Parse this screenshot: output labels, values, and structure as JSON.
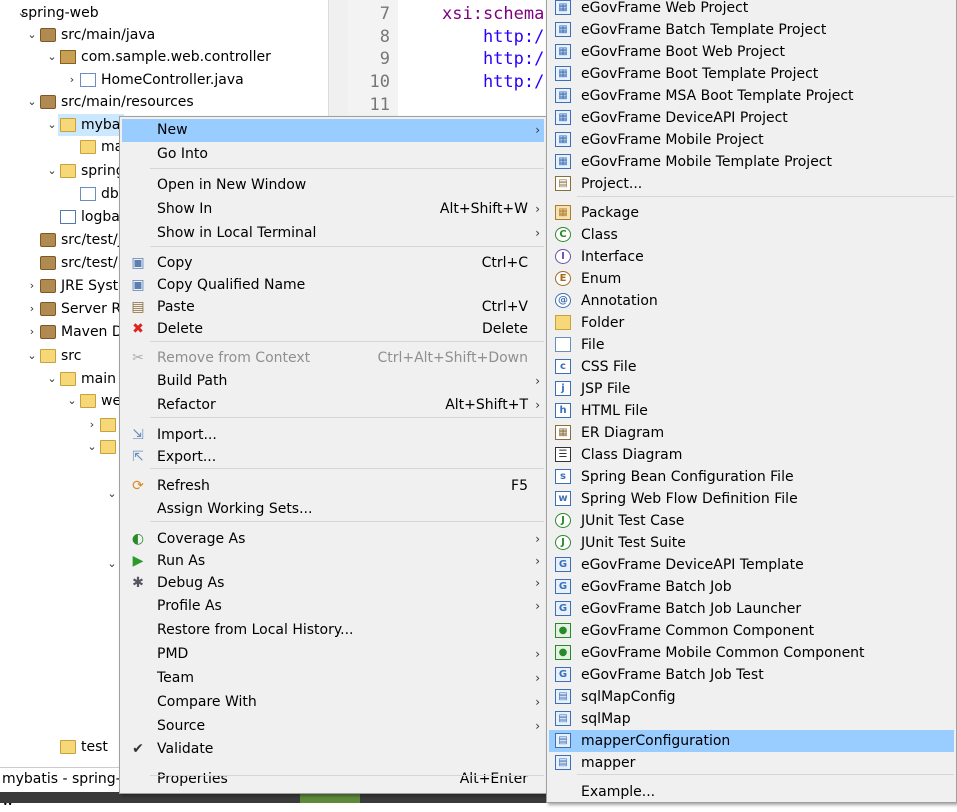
{
  "explorer": {
    "items": [
      {
        "label": "spring-web",
        "twisty": "⌄",
        "icon": "project-icon"
      },
      {
        "label": "src/main/java",
        "twisty": "⌄",
        "icon": "source-folder-icon"
      },
      {
        "label": "com.sample.web.controller",
        "twisty": "⌄",
        "icon": "package-icon"
      },
      {
        "label": "HomeController.java",
        "twisty": "›",
        "icon": "java-file-icon"
      },
      {
        "label": "src/main/resources",
        "twisty": "⌄",
        "icon": "source-folder-icon"
      },
      {
        "label": "myba",
        "twisty": "⌄",
        "icon": "folder-icon"
      },
      {
        "label": "ma",
        "twisty": "",
        "icon": "folder-icon"
      },
      {
        "label": "spring",
        "twisty": "⌄",
        "icon": "folder-icon"
      },
      {
        "label": "db",
        "twisty": "",
        "icon": "properties-file-icon"
      },
      {
        "label": "logba",
        "twisty": "",
        "icon": "xml-file-icon"
      },
      {
        "label": "src/test/j",
        "twisty": "",
        "icon": "source-folder-icon"
      },
      {
        "label": "src/test/r",
        "twisty": "",
        "icon": "source-folder-icon"
      },
      {
        "label": "JRE Syste",
        "twisty": "›",
        "icon": "library-icon"
      },
      {
        "label": "Server R",
        "twisty": "›",
        "icon": "library-icon"
      },
      {
        "label": "Maven D",
        "twisty": "›",
        "icon": "library-icon"
      },
      {
        "label": "src",
        "twisty": "⌄",
        "icon": "folder-icon"
      },
      {
        "label": "main",
        "twisty": "⌄",
        "icon": "folder-icon"
      },
      {
        "label": "we",
        "twisty": "⌄",
        "icon": "folder-icon"
      },
      {
        "label": "",
        "twisty": "›",
        "icon": "folder-icon"
      },
      {
        "label": "",
        "twisty": "⌄",
        "icon": "folder-icon"
      },
      {
        "label": "",
        "twisty": "⌄",
        "icon": ""
      },
      {
        "label": "",
        "twisty": "⌄",
        "icon": ""
      },
      {
        "label": "test",
        "twisty": "",
        "icon": "folder-icon"
      }
    ]
  },
  "status_bar": {
    "text": "mybatis - spring-w"
  },
  "editor": {
    "line_numbers": [
      "7",
      "8",
      "9",
      "10",
      "11"
    ],
    "lines": [
      {
        "text": "xsi:schema",
        "color": "#7f007f"
      },
      {
        "text": "    http:/",
        "color": "#2a00ff"
      },
      {
        "text": "    http:/",
        "color": "#2a00ff"
      },
      {
        "text": "    http:/",
        "color": "#2a00ff"
      },
      {
        "text": "",
        "color": "#000000"
      }
    ]
  },
  "context_menu": {
    "items": [
      {
        "label": "New",
        "accel": "",
        "submenu": true,
        "highlighted": true,
        "disabled": false,
        "icon": ""
      },
      {
        "label": "Go Into",
        "accel": "",
        "submenu": false,
        "highlighted": false,
        "disabled": false,
        "icon": ""
      },
      {
        "label": "Open in New Window",
        "accel": "",
        "submenu": false,
        "highlighted": false,
        "disabled": false,
        "icon": ""
      },
      {
        "label": "Show In",
        "accel": "Alt+Shift+W",
        "submenu": true,
        "highlighted": false,
        "disabled": false,
        "icon": ""
      },
      {
        "label": "Show in Local Terminal",
        "accel": "",
        "submenu": true,
        "highlighted": false,
        "disabled": false,
        "icon": ""
      },
      {
        "label": "Copy",
        "accel": "Ctrl+C",
        "submenu": false,
        "highlighted": false,
        "disabled": false,
        "icon": "copy-icon"
      },
      {
        "label": "Copy Qualified Name",
        "accel": "",
        "submenu": false,
        "highlighted": false,
        "disabled": false,
        "icon": "copy-qualified-icon"
      },
      {
        "label": "Paste",
        "accel": "Ctrl+V",
        "submenu": false,
        "highlighted": false,
        "disabled": false,
        "icon": "paste-icon"
      },
      {
        "label": "Delete",
        "accel": "Delete",
        "submenu": false,
        "highlighted": false,
        "disabled": false,
        "icon": "delete-icon"
      },
      {
        "label": "Remove from Context",
        "accel": "Ctrl+Alt+Shift+Down",
        "submenu": false,
        "highlighted": false,
        "disabled": true,
        "icon": "remove-context-icon"
      },
      {
        "label": "Build Path",
        "accel": "",
        "submenu": true,
        "highlighted": false,
        "disabled": false,
        "icon": ""
      },
      {
        "label": "Refactor",
        "accel": "Alt+Shift+T",
        "submenu": true,
        "highlighted": false,
        "disabled": false,
        "icon": ""
      },
      {
        "label": "Import...",
        "accel": "",
        "submenu": false,
        "highlighted": false,
        "disabled": false,
        "icon": "import-icon"
      },
      {
        "label": "Export...",
        "accel": "",
        "submenu": false,
        "highlighted": false,
        "disabled": false,
        "icon": "export-icon"
      },
      {
        "label": "Refresh",
        "accel": "F5",
        "submenu": false,
        "highlighted": false,
        "disabled": false,
        "icon": "refresh-icon"
      },
      {
        "label": "Assign Working Sets...",
        "accel": "",
        "submenu": false,
        "highlighted": false,
        "disabled": false,
        "icon": ""
      },
      {
        "label": "Coverage As",
        "accel": "",
        "submenu": true,
        "highlighted": false,
        "disabled": false,
        "icon": "coverage-icon"
      },
      {
        "label": "Run As",
        "accel": "",
        "submenu": true,
        "highlighted": false,
        "disabled": false,
        "icon": "run-icon"
      },
      {
        "label": "Debug As",
        "accel": "",
        "submenu": true,
        "highlighted": false,
        "disabled": false,
        "icon": "debug-icon"
      },
      {
        "label": "Profile As",
        "accel": "",
        "submenu": true,
        "highlighted": false,
        "disabled": false,
        "icon": ""
      },
      {
        "label": "Restore from Local History...",
        "accel": "",
        "submenu": false,
        "highlighted": false,
        "disabled": false,
        "icon": ""
      },
      {
        "label": "PMD",
        "accel": "",
        "submenu": true,
        "highlighted": false,
        "disabled": false,
        "icon": ""
      },
      {
        "label": "Team",
        "accel": "",
        "submenu": true,
        "highlighted": false,
        "disabled": false,
        "icon": ""
      },
      {
        "label": "Compare With",
        "accel": "",
        "submenu": true,
        "highlighted": false,
        "disabled": false,
        "icon": ""
      },
      {
        "label": "Source",
        "accel": "",
        "submenu": true,
        "highlighted": false,
        "disabled": false,
        "icon": ""
      },
      {
        "label": "Validate",
        "accel": "",
        "submenu": false,
        "highlighted": false,
        "disabled": false,
        "icon": "check-icon"
      },
      {
        "label": "Properties",
        "accel": "Alt+Enter",
        "submenu": false,
        "highlighted": false,
        "disabled": false,
        "icon": ""
      }
    ]
  },
  "new_submenu": {
    "items": [
      {
        "label": "eGovFrame Web Project",
        "icon": "egov-project-icon",
        "highlighted": false
      },
      {
        "label": "eGovFrame Batch Template Project",
        "icon": "egov-project-icon",
        "highlighted": false
      },
      {
        "label": "eGovFrame Boot Web Project",
        "icon": "egov-project-icon",
        "highlighted": false
      },
      {
        "label": "eGovFrame Boot Template Project",
        "icon": "egov-project-icon",
        "highlighted": false
      },
      {
        "label": "eGovFrame MSA Boot Template Project",
        "icon": "egov-project-icon",
        "highlighted": false
      },
      {
        "label": "eGovFrame DeviceAPI Project",
        "icon": "egov-project-icon",
        "highlighted": false
      },
      {
        "label": "eGovFrame Mobile Project",
        "icon": "egov-project-icon",
        "highlighted": false
      },
      {
        "label": "eGovFrame Mobile Template Project",
        "icon": "egov-project-icon",
        "highlighted": false
      },
      {
        "label": "Project...",
        "icon": "project-icon",
        "highlighted": false
      },
      {
        "label": "Package",
        "icon": "package-icon",
        "highlighted": false
      },
      {
        "label": "Class",
        "icon": "class-icon",
        "highlighted": false
      },
      {
        "label": "Interface",
        "icon": "interface-icon",
        "highlighted": false
      },
      {
        "label": "Enum",
        "icon": "enum-icon",
        "highlighted": false
      },
      {
        "label": "Annotation",
        "icon": "annotation-icon",
        "highlighted": false
      },
      {
        "label": "Folder",
        "icon": "folder-icon",
        "highlighted": false
      },
      {
        "label": "File",
        "icon": "file-icon",
        "highlighted": false
      },
      {
        "label": "CSS File",
        "icon": "css-file-icon",
        "highlighted": false
      },
      {
        "label": "JSP File",
        "icon": "jsp-file-icon",
        "highlighted": false
      },
      {
        "label": "HTML File",
        "icon": "html-file-icon",
        "highlighted": false
      },
      {
        "label": "ER Diagram",
        "icon": "er-diagram-icon",
        "highlighted": false
      },
      {
        "label": "Class Diagram",
        "icon": "class-diagram-icon",
        "highlighted": false
      },
      {
        "label": "Spring Bean Configuration File",
        "icon": "spring-bean-icon",
        "highlighted": false
      },
      {
        "label": "Spring Web Flow Definition File",
        "icon": "web-flow-icon",
        "highlighted": false
      },
      {
        "label": "JUnit Test Case",
        "icon": "junit-icon",
        "highlighted": false
      },
      {
        "label": "JUnit Test Suite",
        "icon": "junit-icon",
        "highlighted": false
      },
      {
        "label": "eGovFrame DeviceAPI Template",
        "icon": "egov-template-icon",
        "highlighted": false
      },
      {
        "label": "eGovFrame Batch Job",
        "icon": "egov-template-icon",
        "highlighted": false
      },
      {
        "label": "eGovFrame Batch Job Launcher",
        "icon": "egov-template-icon",
        "highlighted": false
      },
      {
        "label": "eGovFrame Common Component",
        "icon": "egov-component-icon",
        "highlighted": false
      },
      {
        "label": "eGovFrame Mobile Common Component",
        "icon": "egov-component-icon",
        "highlighted": false
      },
      {
        "label": "eGovFrame Batch Job Test",
        "icon": "egov-template-icon",
        "highlighted": false
      },
      {
        "label": "sqlMapConfig",
        "icon": "sqlmap-icon",
        "highlighted": false
      },
      {
        "label": "sqlMap",
        "icon": "sqlmap-icon",
        "highlighted": false
      },
      {
        "label": "mapperConfiguration",
        "icon": "mapper-icon",
        "highlighted": true
      },
      {
        "label": "mapper",
        "icon": "mapper-icon",
        "highlighted": false
      },
      {
        "label": "Example...",
        "icon": "",
        "highlighted": false
      }
    ]
  },
  "colors": {
    "highlight": "#99ccff",
    "menu_bg": "#f0f0f0",
    "disabled_text": "#8f8f8f"
  }
}
